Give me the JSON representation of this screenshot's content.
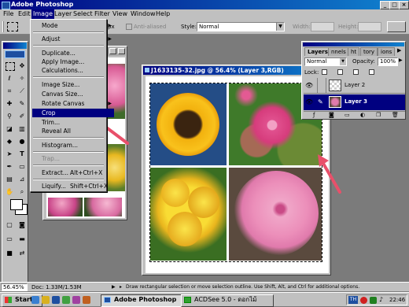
{
  "app": {
    "title": "Adobe Photoshop"
  },
  "window_controls": {
    "minimize": "_",
    "maximize": "□",
    "close": "×"
  },
  "menubar": [
    {
      "label": "File"
    },
    {
      "label": "Edit"
    },
    {
      "label": "Image",
      "active": true
    },
    {
      "label": "Layer"
    },
    {
      "label": "Select"
    },
    {
      "label": "Filter"
    },
    {
      "label": "View"
    },
    {
      "label": "Window"
    },
    {
      "label": "Help"
    }
  ],
  "options": {
    "feather_unit": "px",
    "antialiased": "Anti-aliased",
    "style_label": "Style:",
    "style_value": "Normal",
    "width_label": "Width:",
    "height_label": "Height:"
  },
  "image_menu": {
    "items": [
      {
        "label": "Mode",
        "submenu": true
      },
      {
        "label": "Adjust",
        "submenu": true
      },
      {
        "label": "Duplicate..."
      },
      {
        "label": "Apply Image..."
      },
      {
        "label": "Calculations..."
      },
      {
        "label": "Image Size..."
      },
      {
        "label": "Canvas Size..."
      },
      {
        "label": "Rotate Canvas",
        "submenu": true
      },
      {
        "label": "Crop",
        "highlighted": true
      },
      {
        "label": "Trim..."
      },
      {
        "label": "Reveal All"
      },
      {
        "label": "Histogram..."
      },
      {
        "label": "Trap...",
        "disabled": true
      },
      {
        "label": "Extract...",
        "shortcut": "Alt+Ctrl+X"
      },
      {
        "label": "Liquify...",
        "shortcut": "Shift+Ctrl+X"
      }
    ]
  },
  "document": {
    "title": "J1633135-32.jpg @ 56.4% (Layer 3,RGB)"
  },
  "layers_panel": {
    "tabs": [
      "Layers",
      "Channels",
      "Paths",
      "History",
      "Actions"
    ],
    "tab_short": [
      "Layers",
      "nnels",
      "ht",
      "tory",
      "ions"
    ],
    "blend_mode": "Normal",
    "opacity_label": "Opacity:",
    "opacity_value": "100%",
    "lock_label": "Lock:",
    "layers": [
      {
        "name": "Layer 2",
        "selected": false
      },
      {
        "name": "Layer 3",
        "selected": true
      }
    ]
  },
  "status": {
    "zoom": "56.45%",
    "doc_size": "Doc: 1.33M/1.53M",
    "hint": "Draw rectangular selection or move selection outline. Use Shift, Alt, and Ctrl for additional options."
  },
  "taskbar": {
    "start": "Start",
    "buttons": [
      {
        "label": "Adobe Photoshop",
        "pressed": true
      },
      {
        "label": "ACDSee 5.0 - ดอกไม้",
        "pressed": false
      }
    ],
    "tray_lang": "TH",
    "clock": "22:46"
  },
  "colors": {
    "title_active": "#000080",
    "face": "#c0c0c0",
    "workspace": "#7b7b7b",
    "highlight": "#000080",
    "arrow": "#e8506a"
  }
}
